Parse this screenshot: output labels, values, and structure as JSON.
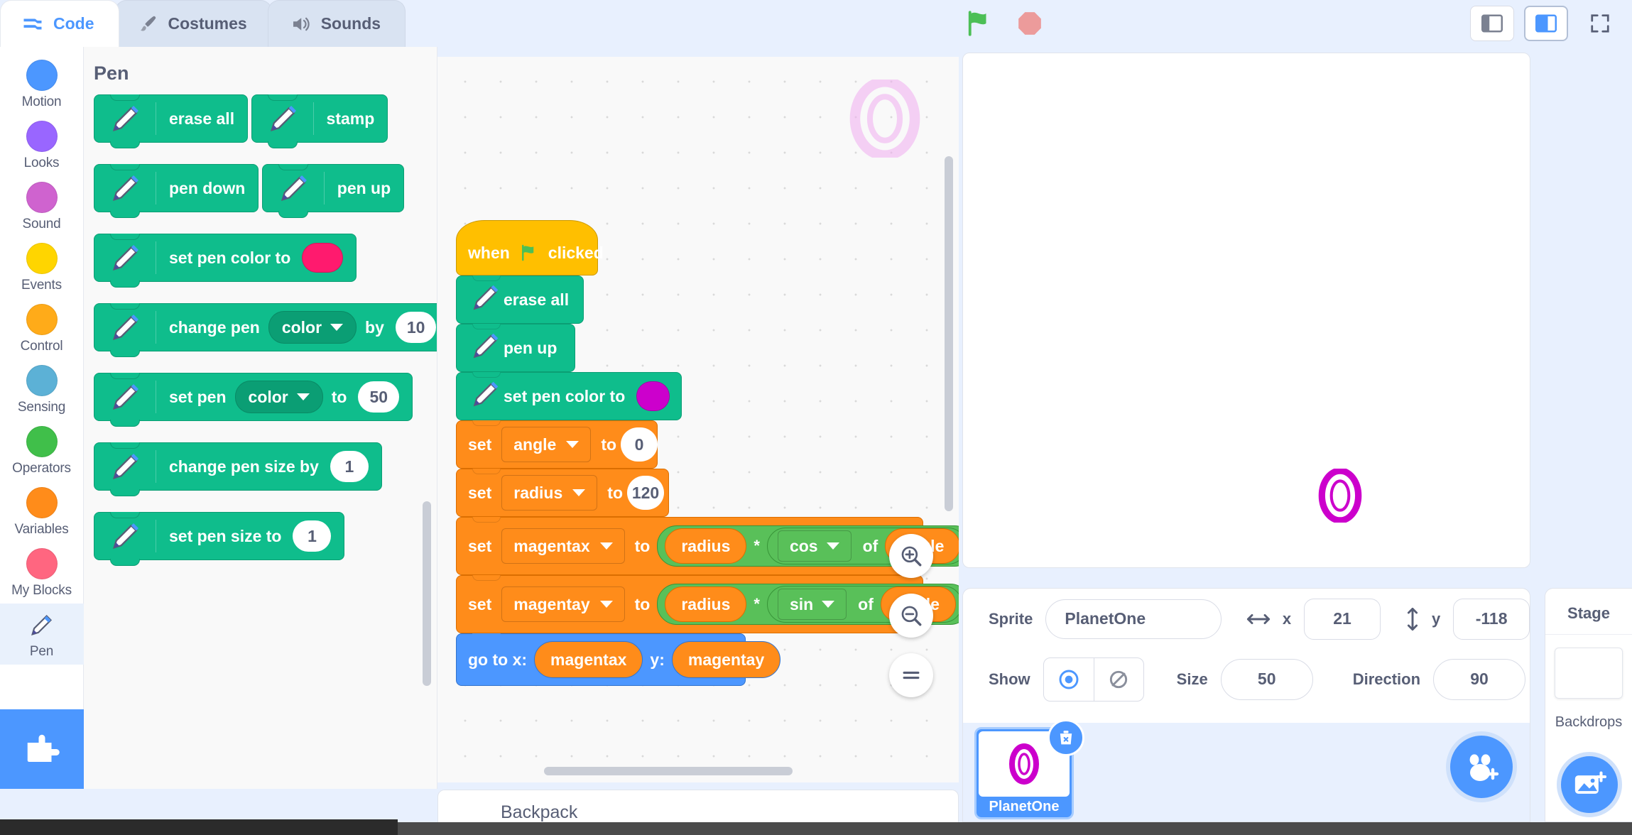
{
  "tabs": [
    {
      "label": "Code",
      "icon": "code-icon",
      "active": true
    },
    {
      "label": "Costumes",
      "icon": "brush-icon",
      "active": false
    },
    {
      "label": "Sounds",
      "icon": "speaker-icon",
      "active": false
    }
  ],
  "controls": {
    "green_flag": "green-flag-icon",
    "stop": "stop-sign-icon",
    "small_stage": "small-stage-icon",
    "large_stage": "large-stage-icon",
    "fullscreen": "fullscreen-icon"
  },
  "categories": [
    {
      "label": "Motion",
      "color": "#4c97ff",
      "selected": false
    },
    {
      "label": "Looks",
      "color": "#9966ff",
      "selected": false
    },
    {
      "label": "Sound",
      "color": "#cf63cf",
      "selected": false
    },
    {
      "label": "Events",
      "color": "#ffd500",
      "selected": false
    },
    {
      "label": "Control",
      "color": "#ffab19",
      "selected": false
    },
    {
      "label": "Sensing",
      "color": "#5cb1d6",
      "selected": false
    },
    {
      "label": "Operators",
      "color": "#40bf4a",
      "selected": false
    },
    {
      "label": "Variables",
      "color": "#ff8c1a",
      "selected": false
    },
    {
      "label": "My Blocks",
      "color": "#ff6680",
      "selected": false
    },
    {
      "label": "Pen",
      "color": "#0fbd8c",
      "selected": true
    }
  ],
  "add_extension_label": "add-extension-button",
  "palette": {
    "title": "Pen",
    "blocks": [
      {
        "id": "erase-all",
        "label": "erase all"
      },
      {
        "id": "stamp",
        "label": "stamp"
      },
      {
        "id": "pen-down",
        "label": "pen down"
      },
      {
        "id": "pen-up",
        "label": "pen up"
      },
      {
        "id": "set-pen-color-to",
        "label": "set pen color to",
        "swatch": "#ff1a6e"
      },
      {
        "id": "change-pen-by",
        "label_a": "change pen",
        "dropdown": "color",
        "label_b": "by",
        "value": "10"
      },
      {
        "id": "set-pen-to",
        "label_a": "set pen",
        "dropdown": "color",
        "label_b": "to",
        "value": "50"
      },
      {
        "id": "change-pen-size",
        "label": "change pen size by",
        "value": "1"
      },
      {
        "id": "set-pen-size",
        "label": "set pen size to",
        "value": "1"
      }
    ]
  },
  "script": {
    "hat": {
      "pre": "when",
      "post": "clicked",
      "icon": "green-flag-icon"
    },
    "erase_all": "erase all",
    "pen_up": "pen up",
    "set_pen_color": {
      "label": "set pen color to",
      "swatch": "#cc00cc"
    },
    "set_angle": {
      "set": "set",
      "var": "angle",
      "to": "to",
      "value": "0"
    },
    "set_radius": {
      "set": "set",
      "var": "radius",
      "to": "to",
      "value": "120"
    },
    "set_magentax": {
      "set": "set",
      "var": "magentax",
      "to": "to",
      "operand_a": "radius",
      "op": "*",
      "fn": "cos",
      "of": "of",
      "operand_b": "angle"
    },
    "set_magentay": {
      "set": "set",
      "var": "magentay",
      "to": "to",
      "operand_a": "radius",
      "op": "*",
      "fn": "sin",
      "of": "of",
      "operand_b": "angle"
    },
    "go_to": {
      "x_label": "go to x:",
      "x_var": "magentax",
      "y_label": "y:",
      "y_var": "magentay"
    }
  },
  "workspace": {
    "zoom_in": "zoom-in-icon",
    "zoom_out": "zoom-out-icon",
    "zoom_reset": "zoom-reset-icon"
  },
  "sprite_info": {
    "sprite_label": "Sprite",
    "sprite_name": "PlanetOne",
    "x_label": "x",
    "x_value": "21",
    "y_label": "y",
    "y_value": "-118",
    "show_label": "Show",
    "size_label": "Size",
    "size_value": "50",
    "direction_label": "Direction",
    "direction_value": "90"
  },
  "sprite_list": {
    "sprites": [
      {
        "name": "PlanetOne",
        "selected": true
      }
    ],
    "add_sprite": "add-sprite-button",
    "delete_badge": "delete-sprite-icon"
  },
  "stage_panel": {
    "title": "Stage",
    "backdrops_label": "Backdrops",
    "add_backdrop": "add-backdrop-button"
  },
  "backpack": {
    "label": "Backpack"
  },
  "colors": {
    "pen_green": "#0fbd8c",
    "variables_orange": "#ff8c1a",
    "operators_green": "#59c059",
    "motion_blue": "#4c97ff",
    "events_yellow": "#ffbf00",
    "accent_blue": "#4c97ff",
    "sprite_magenta": "#cc00cc"
  }
}
